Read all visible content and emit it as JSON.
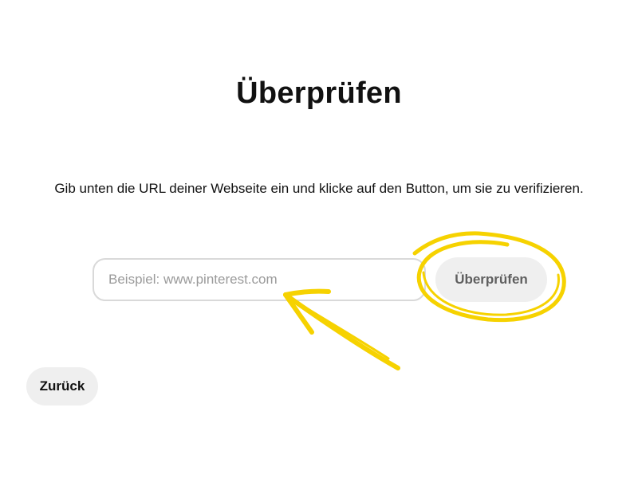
{
  "page": {
    "title": "Überprüfen",
    "description": "Gib unten die URL deiner Webseite ein und klicke auf den Button, um sie zu verifizieren."
  },
  "form": {
    "url_placeholder": "Beispiel: www.pinterest.com",
    "url_value": "",
    "verify_label": "Überprüfen"
  },
  "navigation": {
    "back_label": "Zurück"
  },
  "colors": {
    "annotation_yellow": "#f6d200",
    "button_background": "#efefef",
    "input_border": "#d9d9d9",
    "placeholder_text": "#9a9a9a"
  },
  "annotations": {
    "circle_icon": "hand-drawn-circle-icon",
    "arrow_icon": "hand-drawn-arrow-icon"
  }
}
